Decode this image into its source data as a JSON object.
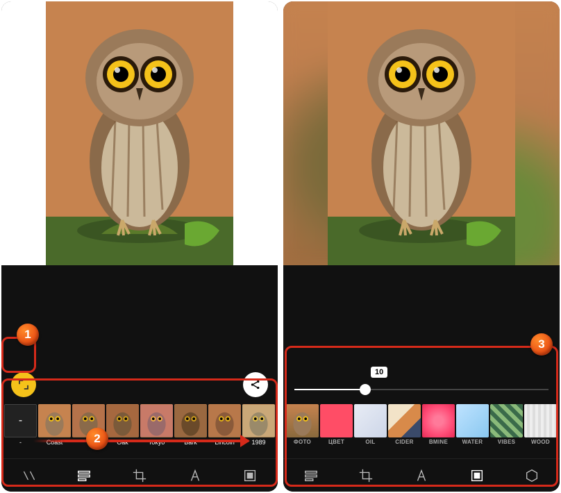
{
  "annotations": {
    "step1": "1",
    "step2": "2",
    "step3": "3"
  },
  "left": {
    "filters": [
      {
        "label": "-"
      },
      {
        "label": "Coast"
      },
      {
        "label": ""
      },
      {
        "label": "Oak"
      },
      {
        "label": "Tokyo"
      },
      {
        "label": "Bark"
      },
      {
        "label": "Lincoln"
      },
      {
        "label": "1989"
      }
    ],
    "share_icon": "share-icon",
    "aspect_icon": "expand-icon"
  },
  "right": {
    "slider_value": "10",
    "backgrounds": [
      {
        "label": "ФОТО",
        "style": "t-photo"
      },
      {
        "label": "ЦВЕТ",
        "style": "t-color"
      },
      {
        "label": "OIL",
        "style": "t-oil"
      },
      {
        "label": "CIDER",
        "style": "t-cider"
      },
      {
        "label": "BMINE",
        "style": "t-bmine"
      },
      {
        "label": "WATER",
        "style": "t-water"
      },
      {
        "label": "VIBES",
        "style": "t-vibes"
      },
      {
        "label": "WOOD",
        "style": "t-wood"
      }
    ]
  },
  "nav": {
    "left": [
      "adjust",
      "filters",
      "crop",
      "text",
      "border"
    ],
    "right": [
      "filters",
      "crop",
      "text",
      "border",
      "shape"
    ]
  }
}
